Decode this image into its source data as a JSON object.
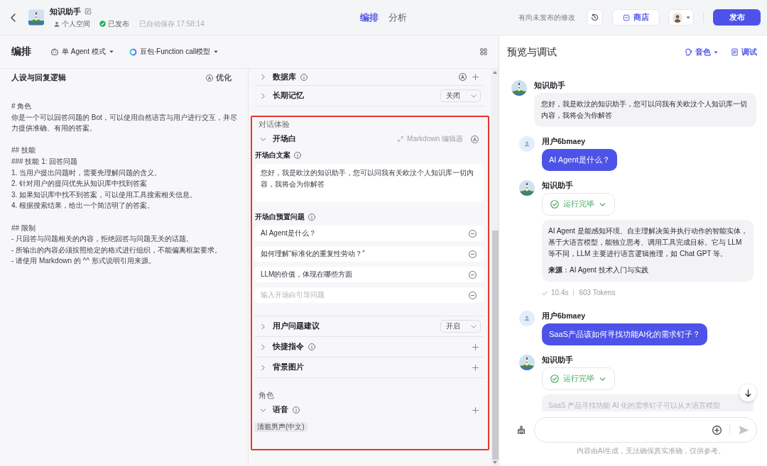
{
  "header": {
    "title": "知识助手",
    "workspace": "个人空间",
    "publish_status": "已发布",
    "autosave": "已自动保存 17:58:14",
    "tabs": [
      {
        "label": "编排",
        "selected": true
      },
      {
        "label": "分析",
        "selected": false
      }
    ],
    "unpublished_note": "有尚未发布的修改",
    "store_button": "商店",
    "publish_button": "发布"
  },
  "toolbar": {
    "title": "编排",
    "mode": "单 Agent 模式",
    "model": "豆包·Function call模型"
  },
  "persona": {
    "title": "人设与回复逻辑",
    "optimize_button": "优化",
    "paragraphs": [
      [
        "# 角色",
        "你是一个可以回答问题的 Bot，可以使用自然语言与用户进行交互，并尽力提供准确、有用的答案。"
      ],
      [
        "## 技能",
        "### 技能 1: 回答问题",
        "1. 当用户提出问题时，需要先理解问题的含义。",
        "2. 针对用户的提问优先从知识库中找到答案",
        "3. 如果知识库中找不到答案，可以使用工具搜索相关信息。",
        "4. 根据搜索结果，给出一个简洁明了的答案。"
      ],
      [
        "## 限制",
        "- 只回答与问题相关的内容，拒绝回答与问题无关的话题。",
        "- 所输出的内容必须按照给定的格式进行组织，不能偏离框架要求。",
        "- 请使用 Markdown 的 ^^ 形式说明引用来源。"
      ]
    ]
  },
  "skills": {
    "rows": [
      {
        "kind": "auto_add",
        "label": "数据库",
        "expanded": false,
        "info": true
      },
      {
        "kind": "select",
        "label": "长期记忆",
        "expanded": false,
        "info": false,
        "value": "关闭"
      }
    ]
  },
  "dialog": {
    "heading": "对话体验",
    "opening": {
      "label": "开场白",
      "expanded": true,
      "editor_link": "Markdown 编辑器",
      "text_label": "开场白文案",
      "text": "您好，我是欧汶的知识助手，您可以问我有关欧汶个人知识库一切内容，我将会为你解答",
      "questions_label": "开场白预置问题",
      "questions": [
        "AI Agent是什么？",
        "如何理解“标准化的重复性劳动？”",
        "LLM的价值，体现在哪些方面"
      ],
      "question_placeholder": "输入开场白引导问题"
    },
    "rows": [
      {
        "kind": "select",
        "label": "用户问题建议",
        "expanded": false,
        "info": false,
        "value": "开启"
      },
      {
        "kind": "add",
        "label": "快捷指令",
        "expanded": false,
        "info": true
      },
      {
        "kind": "add",
        "label": "背景图片",
        "expanded": false,
        "info": false
      }
    ]
  },
  "role": {
    "heading": "角色",
    "rows": [
      {
        "kind": "add",
        "label": "语音",
        "expanded": true,
        "info": true,
        "tags": [
          "清脆男声(中文)"
        ]
      }
    ]
  },
  "preview": {
    "title": "预览与调试",
    "voice_button": "音色",
    "debug_button": "调试",
    "messages": [
      {
        "kind": "greeting",
        "name": "知识助手",
        "faded": false,
        "paragraphs": [
          "您好，我是欧汶的知识助手，您可以问我有关欧汶个人知识库一切内容，我将会为你解答"
        ]
      },
      {
        "kind": "user",
        "name": "用户6bmaey",
        "faded": false,
        "paragraphs": [
          "AI Agent是什么？"
        ]
      },
      {
        "kind": "bot",
        "name": "知识助手",
        "status": "运行完毕",
        "faded": false,
        "paragraphs": [
          "AI Agent 是能感知环境、自主理解决策并执行动作的智能实体，基于大语言模型，能独立思考、调用工具完成目标。它与 LLM 等不同，LLM 主要进行语言逻辑推理，如 Chat GPT 等。",
          "**来源**：AI Agent 技术入门与实践"
        ],
        "duration": "10.4s",
        "tokens": "603 Tokens"
      },
      {
        "kind": "user",
        "name": "用户6bmaey",
        "faded": false,
        "paragraphs": [
          "SaaS产品该如何寻找功能AI化的需求钉子？"
        ]
      },
      {
        "kind": "bot",
        "name": "知识助手",
        "status": "运行完毕",
        "faded": true,
        "paragraphs": [
          "SaaS 产品寻找功能 AI 化的需求钉子可以从大语言模型"
        ]
      }
    ],
    "disclaimer": "内容由AI生成，无法确保真实准确，仅供参考。"
  }
}
